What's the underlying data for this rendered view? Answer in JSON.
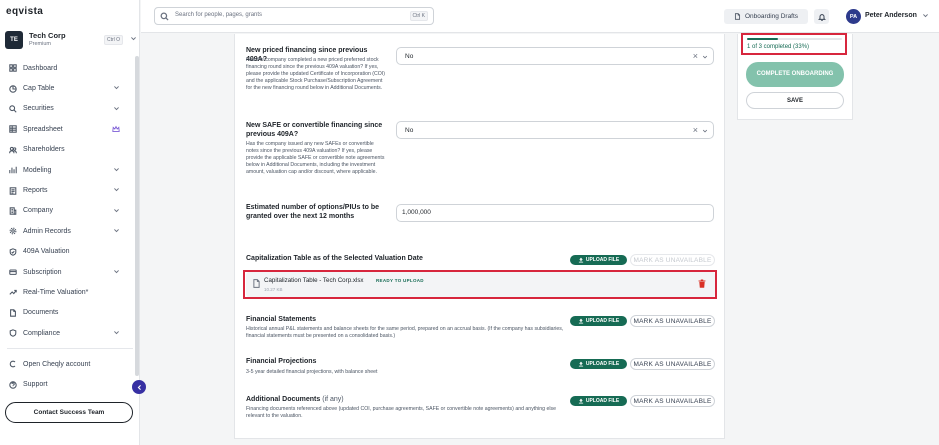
{
  "app": {
    "logo": "eqvista",
    "company_initials": "TE",
    "company_name": "Tech Corp",
    "company_plan": "Premium",
    "company_shortcut": "Ctrl O"
  },
  "nav": {
    "items": [
      {
        "label": "Dashboard"
      },
      {
        "label": "Cap Table"
      },
      {
        "label": "Securities"
      },
      {
        "label": "Spreadsheet"
      },
      {
        "label": "Shareholders"
      },
      {
        "label": "Modeling"
      },
      {
        "label": "Reports"
      },
      {
        "label": "Company"
      },
      {
        "label": "Admin Records"
      },
      {
        "label": "409A Valuation"
      },
      {
        "label": "Subscription"
      },
      {
        "label": "Real-Time Valuation*"
      },
      {
        "label": "Documents"
      },
      {
        "label": "Compliance"
      }
    ],
    "secondary": [
      {
        "label": "Open Cheqly account"
      },
      {
        "label": "Support"
      }
    ],
    "contact_button": "Contact Success Team"
  },
  "topbar": {
    "search_placeholder": "Search for people, pages, grants",
    "search_shortcut": "Ctrl K",
    "drafts_button": "Onboarding Drafts",
    "user_initials": "PA",
    "user_name": "Peter Anderson"
  },
  "form": {
    "q1": {
      "title": "New priced financing since previous 409A?",
      "description": "Has the company completed a new priced preferred stock financing round since the previous 409A valuation? If yes, please provide the updated Certificate of Incorporation (COI) and the applicable Stock Purchase/Subscription Agreement for the new financing round below in Additional Documents.",
      "value": "No"
    },
    "q2": {
      "title": "New SAFE or convertible financing since previous 409A?",
      "description": "Has the company issued any new SAFEs or convertible notes since the previous 409A valuation? If yes, please provide the applicable SAFE or convertible note agreements below in Additional Documents, including the investment amount, valuation cap and/or discount, where applicable.",
      "value": "No"
    },
    "q3": {
      "title": "Estimated number of options/PIUs to be granted over the next 12 months",
      "value": "1,000,000"
    },
    "captable": {
      "title": "Capitalization Table as of the Selected Valuation Date",
      "upload_label": "UPLOAD FILE",
      "unavailable_label": "MARK AS UNAVAILABLE",
      "file_name": "Capitalization Table - Tech Corp.xlsx",
      "file_status": "READY TO UPLOAD",
      "file_size": "10.27 KB"
    },
    "financials": {
      "title": "Financial Statements",
      "description": "Historical annual P&L statements and balance sheets for the same period, prepared on an accrual basis. (If the company has subsidiaries, financial statements must be presented on a consolidated basis.)",
      "upload_label": "UPLOAD FILE",
      "unavailable_label": "MARK AS UNAVAILABLE"
    },
    "projections": {
      "title": "Financial Projections",
      "description": "3-5 year detailed financial projections, with balance sheet",
      "upload_label": "UPLOAD FILE",
      "unavailable_label": "MARK AS UNAVAILABLE"
    },
    "additional": {
      "title": "Additional Documents",
      "title_suffix": "(if any)",
      "description": "Financing documents referenced above (updated COI, purchase agreements, SAFE or convertible note agreements) and anything else relevant to the valuation.",
      "upload_label": "UPLOAD FILE",
      "unavailable_label": "MARK AS UNAVAILABLE"
    }
  },
  "panel": {
    "progress_text": "1 of 3 completed (33%)",
    "progress_fraction": 0.33,
    "complete_label": "COMPLETE ONBOARDING",
    "save_label": "SAVE"
  },
  "colors": {
    "accent_green": "#166b54",
    "highlight_red": "#d7263d",
    "brand_indigo": "#3730a3"
  }
}
